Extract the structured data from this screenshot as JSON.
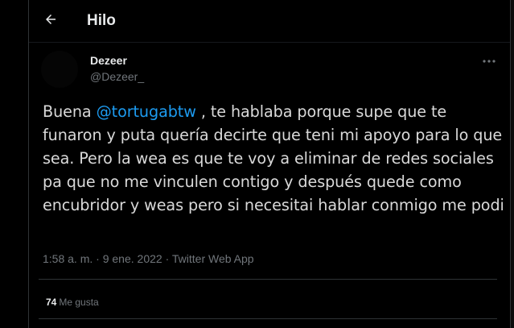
{
  "header": {
    "title": "Hilo",
    "back_icon": "arrow-left-icon"
  },
  "author": {
    "name": "Dezeer",
    "handle": "@Dezeer_",
    "more_icon": "more-dots-icon"
  },
  "tweet": {
    "text_before": "Buena ",
    "mention": "@tortugabtw",
    "text_after": " , te hablaba porque supe que te funaron y puta quería decirte que teni mi apoyo para lo que sea. Pero la wea es que te voy a eliminar de redes sociales pa que no me vinculen contigo y después quede como encubridor y weas pero si necesitai hablar conmigo me podi"
  },
  "meta": {
    "time": "1:58 a. m.",
    "separator": "·",
    "date": "9 ene. 2022",
    "source": "Twitter Web App"
  },
  "likes": {
    "count": "74",
    "label": "Me gusta"
  },
  "colors": {
    "background": "#000000",
    "accent": "#1d9bf0",
    "text_primary": "#e7e9ea",
    "text_secondary": "#71767b",
    "border": "#2f3336"
  }
}
